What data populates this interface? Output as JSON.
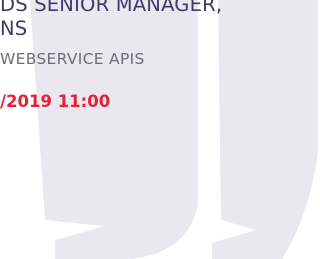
{
  "header": {
    "title_line1": "DS SENIOR MANAGER,",
    "title_line2": "NS",
    "subtitle": "WEBSERVICE APIS",
    "datetime": "/2019 11:00"
  },
  "decoration": {
    "icon": "quotation-mark-icon",
    "color": "#e8e8ee"
  }
}
